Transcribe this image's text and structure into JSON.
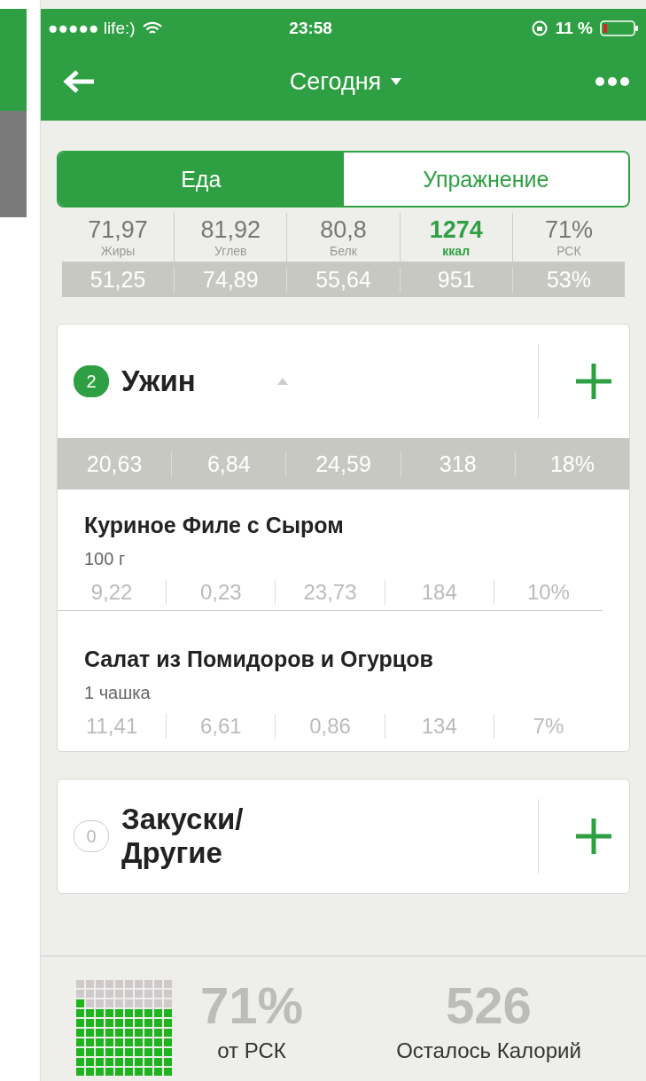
{
  "status_bar": {
    "carrier": "●●●●● life:)",
    "time": "23:58",
    "battery": "11 %"
  },
  "nav": {
    "title": "Сегодня"
  },
  "tabs": [
    {
      "label": "Еда",
      "selected": true
    },
    {
      "label": "Упражнение",
      "selected": false
    }
  ],
  "summary": {
    "columns": [
      {
        "value": "71,97",
        "label": "Жиры",
        "highlight": false
      },
      {
        "value": "81,92",
        "label": "Углев",
        "highlight": false
      },
      {
        "value": "80,8",
        "label": "Белк",
        "highlight": false
      },
      {
        "value": "1274",
        "label": "ккал",
        "highlight": true
      },
      {
        "value": "71%",
        "label": "РСК",
        "highlight": false
      }
    ],
    "remaining": [
      "51,25",
      "74,89",
      "55,64",
      "951",
      "53%"
    ]
  },
  "meals": [
    {
      "count": "2",
      "name": "Ужин",
      "active": true,
      "expanded": true,
      "totals": [
        "20,63",
        "6,84",
        "24,59",
        "318",
        "18%"
      ],
      "items": [
        {
          "name": "Куриное Филе с Сыром",
          "amount": "100 г",
          "values": [
            "9,22",
            "0,23",
            "23,73",
            "184",
            "10%"
          ]
        },
        {
          "name": "Салат из Помидоров и Огурцов",
          "amount": "1 чашка",
          "values": [
            "11,41",
            "6,61",
            "0,86",
            "134",
            "7%"
          ]
        }
      ]
    },
    {
      "count": "0",
      "name": "Закуски/ Другие",
      "active": false,
      "expanded": false
    }
  ],
  "footer": {
    "percent": "71%",
    "percent_label": "от РСК",
    "remaining": "526",
    "remaining_label": "Осталось Калорий"
  }
}
